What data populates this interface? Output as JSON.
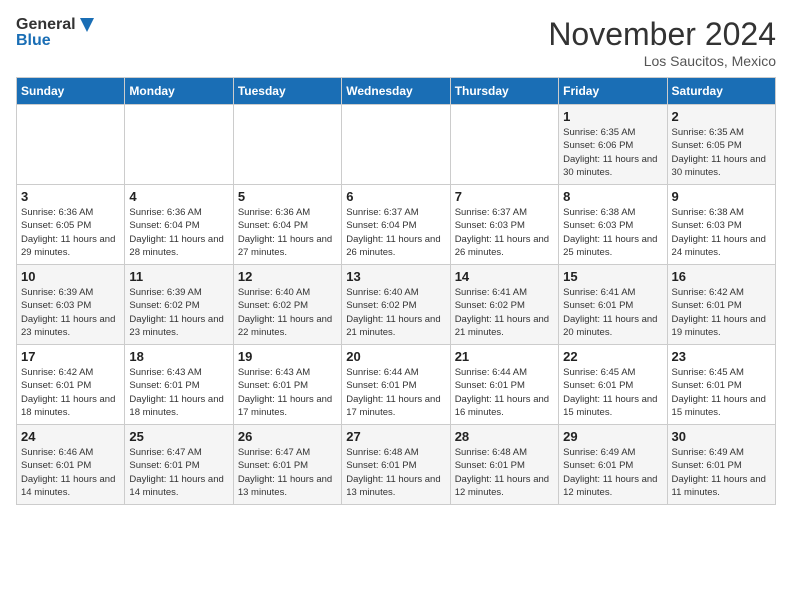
{
  "header": {
    "logo_general": "General",
    "logo_blue": "Blue",
    "month": "November 2024",
    "location": "Los Saucitos, Mexico"
  },
  "days_of_week": [
    "Sunday",
    "Monday",
    "Tuesday",
    "Wednesday",
    "Thursday",
    "Friday",
    "Saturday"
  ],
  "weeks": [
    [
      {
        "day": "",
        "info": ""
      },
      {
        "day": "",
        "info": ""
      },
      {
        "day": "",
        "info": ""
      },
      {
        "day": "",
        "info": ""
      },
      {
        "day": "",
        "info": ""
      },
      {
        "day": "1",
        "info": "Sunrise: 6:35 AM\nSunset: 6:06 PM\nDaylight: 11 hours and 30 minutes."
      },
      {
        "day": "2",
        "info": "Sunrise: 6:35 AM\nSunset: 6:05 PM\nDaylight: 11 hours and 30 minutes."
      }
    ],
    [
      {
        "day": "3",
        "info": "Sunrise: 6:36 AM\nSunset: 6:05 PM\nDaylight: 11 hours and 29 minutes."
      },
      {
        "day": "4",
        "info": "Sunrise: 6:36 AM\nSunset: 6:04 PM\nDaylight: 11 hours and 28 minutes."
      },
      {
        "day": "5",
        "info": "Sunrise: 6:36 AM\nSunset: 6:04 PM\nDaylight: 11 hours and 27 minutes."
      },
      {
        "day": "6",
        "info": "Sunrise: 6:37 AM\nSunset: 6:04 PM\nDaylight: 11 hours and 26 minutes."
      },
      {
        "day": "7",
        "info": "Sunrise: 6:37 AM\nSunset: 6:03 PM\nDaylight: 11 hours and 26 minutes."
      },
      {
        "day": "8",
        "info": "Sunrise: 6:38 AM\nSunset: 6:03 PM\nDaylight: 11 hours and 25 minutes."
      },
      {
        "day": "9",
        "info": "Sunrise: 6:38 AM\nSunset: 6:03 PM\nDaylight: 11 hours and 24 minutes."
      }
    ],
    [
      {
        "day": "10",
        "info": "Sunrise: 6:39 AM\nSunset: 6:03 PM\nDaylight: 11 hours and 23 minutes."
      },
      {
        "day": "11",
        "info": "Sunrise: 6:39 AM\nSunset: 6:02 PM\nDaylight: 11 hours and 23 minutes."
      },
      {
        "day": "12",
        "info": "Sunrise: 6:40 AM\nSunset: 6:02 PM\nDaylight: 11 hours and 22 minutes."
      },
      {
        "day": "13",
        "info": "Sunrise: 6:40 AM\nSunset: 6:02 PM\nDaylight: 11 hours and 21 minutes."
      },
      {
        "day": "14",
        "info": "Sunrise: 6:41 AM\nSunset: 6:02 PM\nDaylight: 11 hours and 21 minutes."
      },
      {
        "day": "15",
        "info": "Sunrise: 6:41 AM\nSunset: 6:01 PM\nDaylight: 11 hours and 20 minutes."
      },
      {
        "day": "16",
        "info": "Sunrise: 6:42 AM\nSunset: 6:01 PM\nDaylight: 11 hours and 19 minutes."
      }
    ],
    [
      {
        "day": "17",
        "info": "Sunrise: 6:42 AM\nSunset: 6:01 PM\nDaylight: 11 hours and 18 minutes."
      },
      {
        "day": "18",
        "info": "Sunrise: 6:43 AM\nSunset: 6:01 PM\nDaylight: 11 hours and 18 minutes."
      },
      {
        "day": "19",
        "info": "Sunrise: 6:43 AM\nSunset: 6:01 PM\nDaylight: 11 hours and 17 minutes."
      },
      {
        "day": "20",
        "info": "Sunrise: 6:44 AM\nSunset: 6:01 PM\nDaylight: 11 hours and 17 minutes."
      },
      {
        "day": "21",
        "info": "Sunrise: 6:44 AM\nSunset: 6:01 PM\nDaylight: 11 hours and 16 minutes."
      },
      {
        "day": "22",
        "info": "Sunrise: 6:45 AM\nSunset: 6:01 PM\nDaylight: 11 hours and 15 minutes."
      },
      {
        "day": "23",
        "info": "Sunrise: 6:45 AM\nSunset: 6:01 PM\nDaylight: 11 hours and 15 minutes."
      }
    ],
    [
      {
        "day": "24",
        "info": "Sunrise: 6:46 AM\nSunset: 6:01 PM\nDaylight: 11 hours and 14 minutes."
      },
      {
        "day": "25",
        "info": "Sunrise: 6:47 AM\nSunset: 6:01 PM\nDaylight: 11 hours and 14 minutes."
      },
      {
        "day": "26",
        "info": "Sunrise: 6:47 AM\nSunset: 6:01 PM\nDaylight: 11 hours and 13 minutes."
      },
      {
        "day": "27",
        "info": "Sunrise: 6:48 AM\nSunset: 6:01 PM\nDaylight: 11 hours and 13 minutes."
      },
      {
        "day": "28",
        "info": "Sunrise: 6:48 AM\nSunset: 6:01 PM\nDaylight: 11 hours and 12 minutes."
      },
      {
        "day": "29",
        "info": "Sunrise: 6:49 AM\nSunset: 6:01 PM\nDaylight: 11 hours and 12 minutes."
      },
      {
        "day": "30",
        "info": "Sunrise: 6:49 AM\nSunset: 6:01 PM\nDaylight: 11 hours and 11 minutes."
      }
    ]
  ]
}
